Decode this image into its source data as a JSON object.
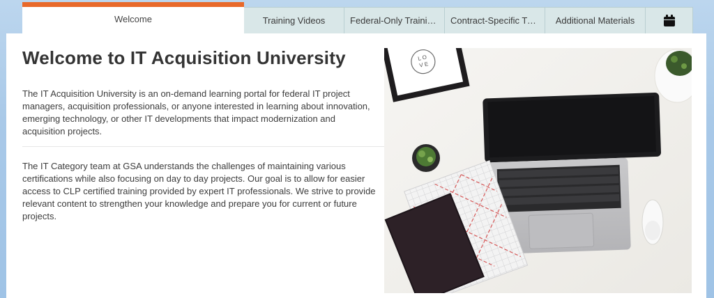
{
  "tabs": [
    {
      "label": "Welcome"
    },
    {
      "label": "Training Videos"
    },
    {
      "label": "Federal-Only Trainings"
    },
    {
      "label": "Contract-Specific Trainings"
    },
    {
      "label": "Additional Materials"
    }
  ],
  "calendar_icon": "calendar-icon",
  "accent_color": "#e8692a",
  "tab_color": "#d9e7e8",
  "content": {
    "title": "Welcome to IT Acquisition University",
    "paragraph1": "The IT Acquisition University is an on-demand learning portal for federal IT project managers, acquisition professionals, or anyone interested in learning about innovation, emerging technology, or other IT developments that impact modernization and acquisition projects.",
    "paragraph2": "The IT Category team at GSA understands the challenges of maintaining various certifications while also focusing on day to day projects. Our goal is to allow for easier access to CLP certified training provided by expert IT professionals. We strive to provide relevant content to strengthen your knowledge and prepare you for current or future projects."
  },
  "hero": {
    "frame_text": "L O V E U S"
  }
}
